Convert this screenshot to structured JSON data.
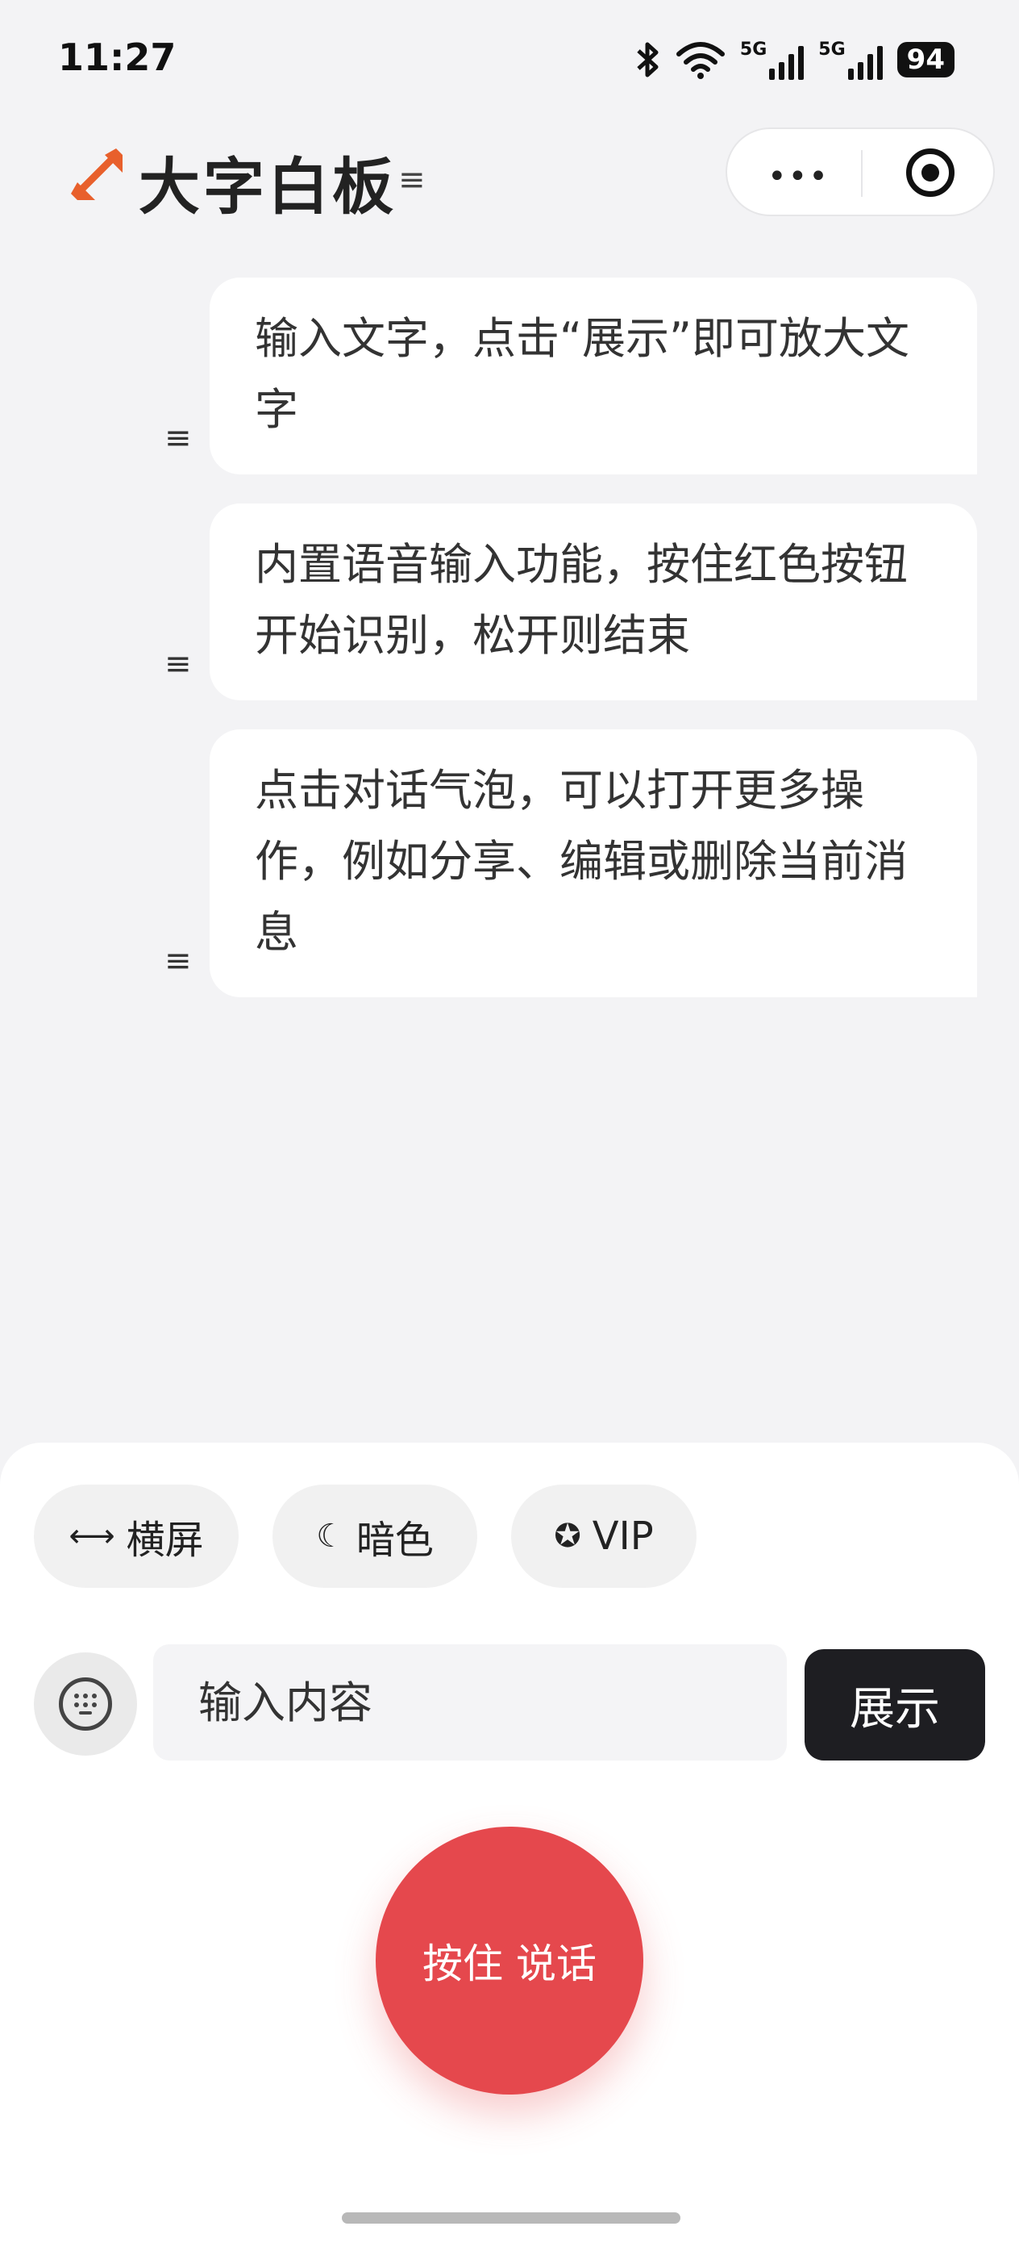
{
  "status_bar": {
    "time": "11:27",
    "network_1": "5G",
    "network_2": "5G",
    "battery": "94"
  },
  "header": {
    "title": "大字白板",
    "menu_glyph": "≡",
    "more_glyph": "•••",
    "brand_color": "#e8602c"
  },
  "messages": [
    {
      "text": "输入文字，点击“展示”即可放大文字"
    },
    {
      "text": "内置语音输入功能，按住红色按钮开始识别，松开则结束"
    },
    {
      "text": "点击对话气泡，可以打开更多操作，例如分享、编辑或删除当前消息"
    }
  ],
  "message_handle_glyph": "≡",
  "chips": [
    {
      "label": "横屏",
      "icon": "arrows-horizontal-icon",
      "glyph": "⟷"
    },
    {
      "label": "暗色",
      "icon": "moon-icon",
      "glyph": "☾"
    },
    {
      "label": "VIP",
      "icon": "badge-check-icon",
      "glyph": "✪"
    }
  ],
  "input": {
    "placeholder": "输入内容",
    "value": ""
  },
  "buttons": {
    "show": "展示",
    "talk": "按住 说话"
  },
  "colors": {
    "talk_button": "#e5484d",
    "show_button": "#1e1e22",
    "background": "#f3f3f5"
  }
}
